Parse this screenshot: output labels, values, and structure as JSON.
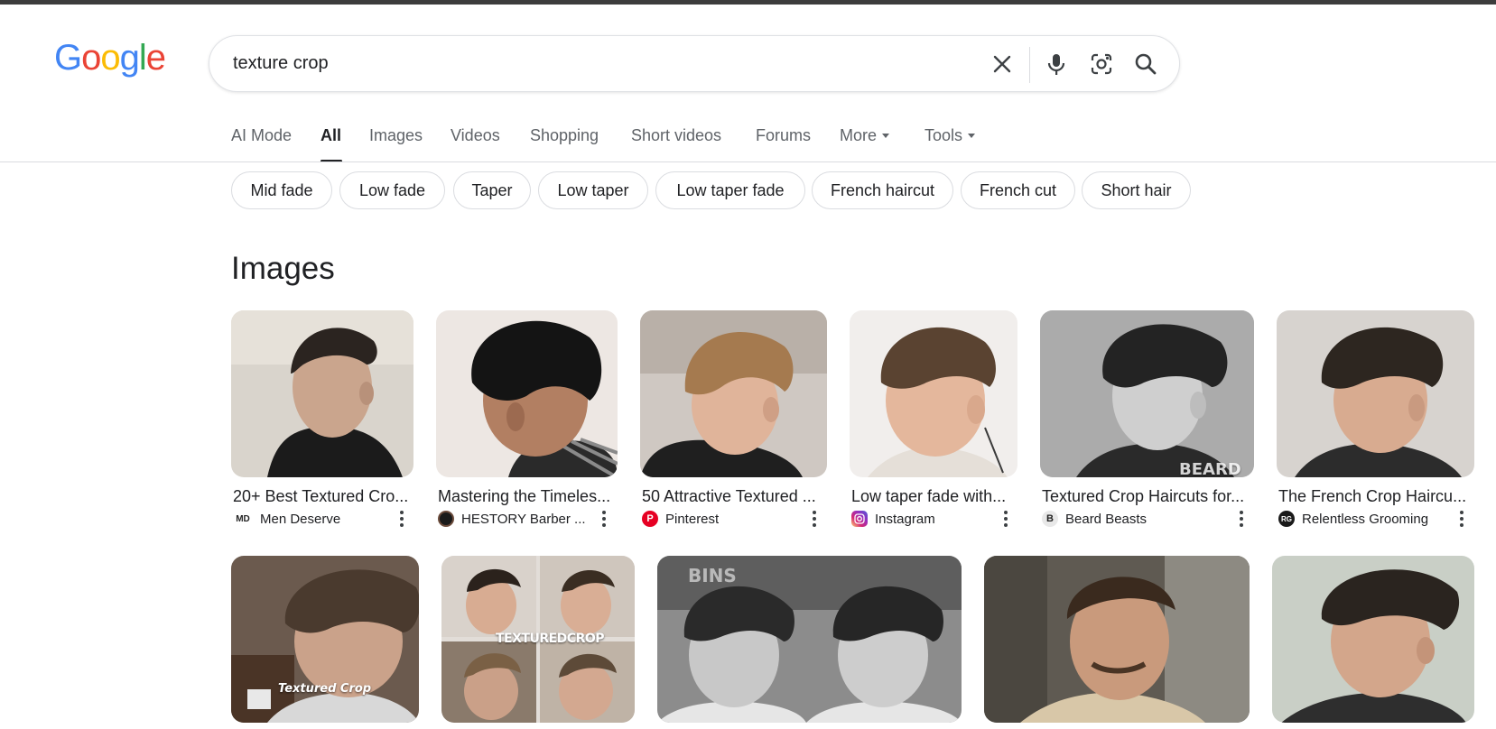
{
  "logo": {
    "letters": [
      "G",
      "o",
      "o",
      "g",
      "l",
      "e"
    ]
  },
  "search": {
    "query": "texture crop"
  },
  "icons": [
    "close-icon",
    "mic-icon",
    "lens-icon",
    "search-icon"
  ],
  "nav": {
    "ai_mode": "AI Mode",
    "all": "All",
    "images": "Images",
    "videos": "Videos",
    "shopping": "Shopping",
    "short_videos": "Short videos",
    "forums": "Forums",
    "more": "More",
    "tools": "Tools"
  },
  "chips": [
    "Mid fade",
    "Low fade",
    "Taper",
    "Low taper",
    "Low taper fade",
    "French haircut",
    "French cut",
    "Short hair"
  ],
  "images_section": {
    "title": "Images",
    "row1": [
      {
        "title": "20+ Best Textured Cro...",
        "source": "Men Deserve",
        "favicon": "MD"
      },
      {
        "title": "Mastering the Timeles...",
        "source": "HESTORY Barber ...",
        "favicon": ""
      },
      {
        "title": "50 Attractive Textured ...",
        "source": "Pinterest",
        "favicon": "P"
      },
      {
        "title": "Low taper fade with...",
        "source": "Instagram",
        "favicon": ""
      },
      {
        "title": "Textured Crop Haircuts for...",
        "source": "Beard Beasts",
        "favicon": "B"
      },
      {
        "title": "The French Crop Haircu...",
        "source": "Relentless Grooming",
        "favicon": "RG"
      }
    ],
    "overlays": {
      "beard": "BEARD",
      "textured_crop_1": "Textured Crop",
      "textured_crop_2": "TEXTUREDCROP",
      "bins": "BINS"
    }
  },
  "colors": {
    "google_blue": "#4285F4",
    "google_red": "#EA4335",
    "google_yellow": "#FBBC05",
    "google_green": "#34A853",
    "pinterest": "#E60023"
  }
}
